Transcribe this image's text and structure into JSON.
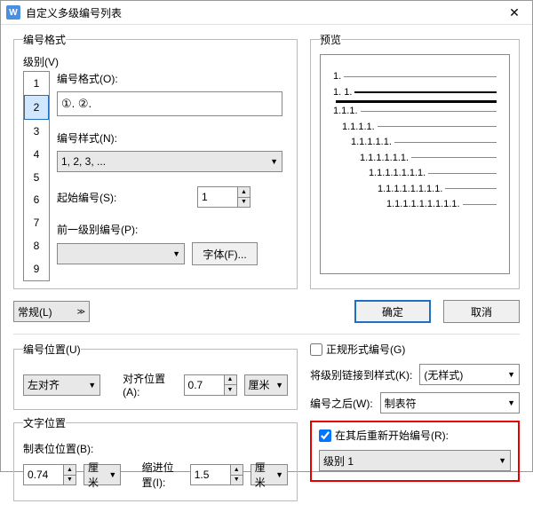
{
  "window": {
    "title": "自定义多级编号列表"
  },
  "format": {
    "legend": "编号格式",
    "level_label": "级别(V)",
    "levels": [
      "1",
      "2",
      "3",
      "4",
      "5",
      "6",
      "7",
      "8",
      "9"
    ],
    "selected_level_idx": 1,
    "format_label": "编号格式(O):",
    "format_value": "①. ②.",
    "style_label": "编号样式(N):",
    "style_value": "1, 2, 3, ...",
    "start_label": "起始编号(S):",
    "start_value": "1",
    "prev_label": "前一级别编号(P):",
    "prev_value": "",
    "font_btn": "字体(F)..."
  },
  "preview": {
    "legend": "预览",
    "lines": [
      "1.",
      "1. 1.",
      "",
      "1.1.1.",
      "1.1.1.1.",
      "1.1.1.1.1.",
      "1.1.1.1.1.1.",
      "1.1.1.1.1.1.1.",
      "1.1.1.1.1.1.1.1.",
      "1.1.1.1.1.1.1.1.1."
    ]
  },
  "common_btn": "常规(L)",
  "ok": "确定",
  "cancel": "取消",
  "num_pos": {
    "legend": "编号位置(U)",
    "align": "左对齐",
    "align_label": "对齐位置(A):",
    "align_value": "0.7",
    "unit": "厘米"
  },
  "text_pos": {
    "legend": "文字位置",
    "tab_label": "制表位位置(B):",
    "tab_value": "0.74",
    "tab_unit": "厘米",
    "indent_label": "缩进位置(I):",
    "indent_value": "1.5",
    "indent_unit": "厘米"
  },
  "right": {
    "formal_label": "正规形式编号(G)",
    "link_label": "将级别链接到样式(K):",
    "link_value": "(无样式)",
    "after_label": "编号之后(W):",
    "after_value": "制表符",
    "restart_label": "在其后重新开始编号(R):",
    "restart_value": "级别 1"
  }
}
